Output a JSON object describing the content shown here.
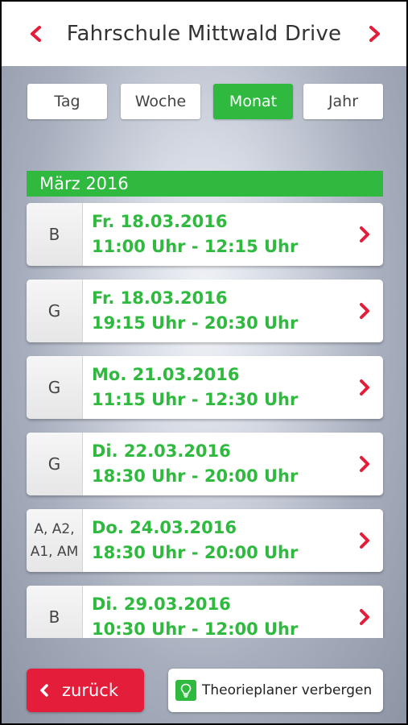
{
  "header": {
    "title": "Fahrschule Mittwald Drive"
  },
  "segments": [
    {
      "label": "Tag",
      "active": false
    },
    {
      "label": "Woche",
      "active": false
    },
    {
      "label": "Monat",
      "active": true
    },
    {
      "label": "Jahr",
      "active": false
    }
  ],
  "month_label": "März 2016",
  "appointments": [
    {
      "class_line1": "B",
      "class_line2": "",
      "date": "Fr. 18.03.2016",
      "time": "11:00 Uhr - 12:15 Uhr"
    },
    {
      "class_line1": "G",
      "class_line2": "",
      "date": "Fr. 18.03.2016",
      "time": "19:15 Uhr - 20:30 Uhr"
    },
    {
      "class_line1": "G",
      "class_line2": "",
      "date": "Mo. 21.03.2016",
      "time": "11:15 Uhr - 12:30 Uhr"
    },
    {
      "class_line1": "G",
      "class_line2": "",
      "date": "Di. 22.03.2016",
      "time": "18:30 Uhr - 20:00 Uhr"
    },
    {
      "class_line1": "A, A2,",
      "class_line2": "A1, AM",
      "date": "Do. 24.03.2016",
      "time": "18:30 Uhr - 20:00 Uhr"
    },
    {
      "class_line1": "B",
      "class_line2": "",
      "date": "Di. 29.03.2016",
      "time": "10:30 Uhr - 12:00 Uhr"
    }
  ],
  "footer": {
    "back_label": "zurück",
    "planner_label": "Theorieplaner verbergen"
  },
  "colors": {
    "accent_green": "#2fb93f",
    "accent_red": "#e41d3a"
  },
  "icons": {
    "prev": "chevron-left-icon",
    "next": "chevron-right-icon",
    "row": "chevron-right-icon",
    "back": "chevron-left-icon",
    "planner": "lightbulb-icon"
  }
}
